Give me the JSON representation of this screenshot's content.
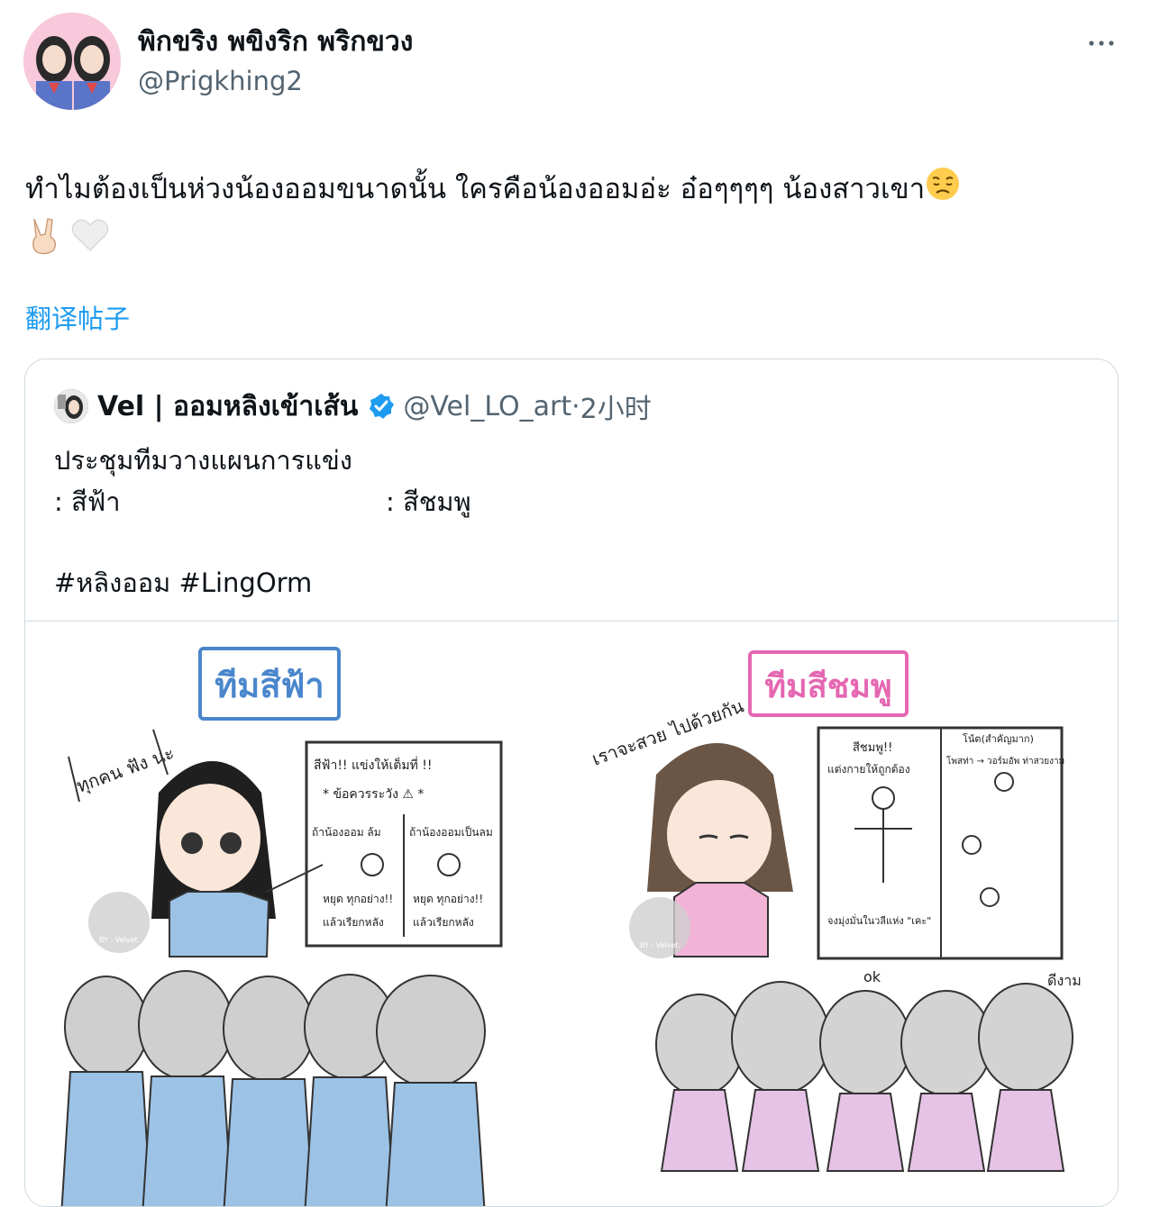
{
  "author": {
    "display_name": "พิกขริง พขิงริก พริกขวง",
    "handle": "@Prigkhing2",
    "avatar_icon": "avatar-photo"
  },
  "menu": {
    "more_icon": "more-horizontal-icon"
  },
  "tweet": {
    "text": "ทำไมต้องเป็นห่วงน้องออมขนาดนั้น ใครคือน้องออมอ่ะ อ๋อๆๆๆๆ น้องสาวเขา",
    "emojis": [
      "disappointed-face-icon",
      "victory-hand-icon",
      "white-heart-icon"
    ]
  },
  "translate_label": "翻译帖子",
  "quote": {
    "display_name": "Vel | ออมหลิงเข้าเส้น",
    "handle": "@Vel_LO_art",
    "separator": "·",
    "time": "2小时",
    "verified_icon": "verified-badge-icon",
    "lines": [
      "ประชุมทีมวางแผนการแข่ง",
      ": สีฟ้า",
      ": สีชมพู",
      "#หลิงออม #LingOrm"
    ],
    "image": {
      "left_title": "ทีมสีฟ้า",
      "right_title": "ทีมสีชมพู",
      "left_board_title": "สีฟ้า!! แข่งให้เต็มที่ !!",
      "left_board_sub": "* ข้อควรระวัง ⚠ *",
      "left_col1_head": "ถ้าน้องออม ล้ม",
      "left_col2_head": "ถ้าน้องออมเป็นลม",
      "left_col_action": "หยุด ทุกอย่าง!!",
      "left_col_footer": "แล้วเรียกหลัง",
      "left_bubble": "ทุกคน ฟัง นะ",
      "right_bubble": "เราจะสวย ไปด้วยกัน",
      "right_board_title": "สีชมพู!!",
      "right_board_line": "แต่งกายให้ถูกต้อง",
      "right_board_note": "โน้ต(สำคัญมาก)",
      "right_board_pose": "โพสท่า → วอร์มอัพ ท่าสวยงาม",
      "right_board_footer": "จงมุ่งมั่นในวลีแห่ง \"เคะ\"",
      "right_ok": "ok",
      "right_nice": "ดีงาม",
      "watermark": "BY : Velvet.",
      "colors": {
        "blue": "#4a86cc",
        "pink": "#e567b1",
        "shirt_blue": "#9cc3e6",
        "shirt_pink": "#f2b4d6",
        "gray": "#c9c9c9"
      }
    }
  }
}
